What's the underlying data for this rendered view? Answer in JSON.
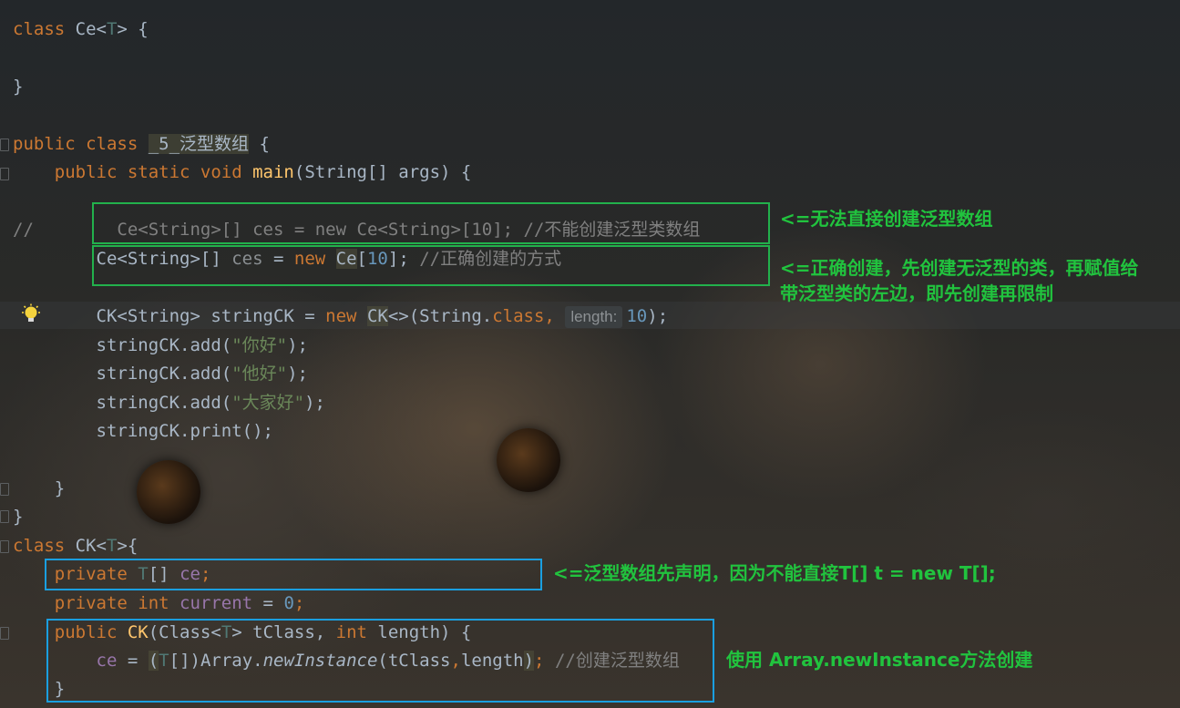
{
  "editor": {
    "lines": [
      {
        "id": "l1",
        "tokens": [
          [
            "kw",
            "class "
          ],
          [
            "",
            "Ce<"
          ],
          [
            "tp",
            "T"
          ],
          [
            "",
            "> {"
          ]
        ]
      },
      {
        "id": "l2",
        "tokens": [
          [
            "",
            "}"
          ]
        ]
      },
      {
        "id": "l3",
        "tokens": [
          [
            "kw",
            "public class "
          ],
          [
            "hl",
            "_5_泛型数组"
          ],
          [
            "",
            " {"
          ]
        ]
      },
      {
        "id": "l4",
        "tokens": [
          [
            "kw",
            "    public static void "
          ],
          [
            "fn",
            "main"
          ],
          [
            "",
            "(String[] args) {"
          ]
        ]
      },
      {
        "id": "l5",
        "tokens": [
          [
            "cmt",
            "//"
          ],
          [
            "cmt",
            "        Ce<String>[] ces = new Ce<String>[10]; //不能创建泛型类数组"
          ]
        ]
      },
      {
        "id": "l6",
        "tokens": [
          [
            "",
            "        Ce<String>[] "
          ],
          [
            "dim",
            "ces"
          ],
          [
            "",
            " = "
          ],
          [
            "kw",
            "new "
          ],
          [
            "hl",
            "Ce"
          ],
          [
            "",
            "["
          ],
          [
            "num",
            "10"
          ],
          [
            "",
            "]; "
          ],
          [
            "cmt",
            "//正确创建的方式"
          ]
        ]
      },
      {
        "id": "l7",
        "tokens": [
          [
            "",
            "        CK<String> stringCK = "
          ],
          [
            "kw",
            "new "
          ],
          [
            "hl",
            "CK"
          ],
          [
            "",
            "<>(String."
          ],
          [
            "kw",
            "class"
          ],
          [
            "kw",
            ", "
          ],
          [
            "hint",
            "length:"
          ],
          [
            "num",
            "10"
          ],
          [
            "",
            ");"
          ]
        ]
      },
      {
        "id": "l8",
        "tokens": [
          [
            "",
            "        stringCK.add("
          ],
          [
            "str",
            "\"你好\""
          ],
          [
            "",
            ");"
          ]
        ]
      },
      {
        "id": "l9",
        "tokens": [
          [
            "",
            "        stringCK.add("
          ],
          [
            "str",
            "\"他好\""
          ],
          [
            "",
            ");"
          ]
        ]
      },
      {
        "id": "l10",
        "tokens": [
          [
            "",
            "        stringCK.add("
          ],
          [
            "str",
            "\"大家好\""
          ],
          [
            "",
            ");"
          ]
        ]
      },
      {
        "id": "l11",
        "tokens": [
          [
            "",
            "        stringCK.print();"
          ]
        ]
      },
      {
        "id": "l12",
        "tokens": [
          [
            "",
            "    }"
          ]
        ]
      },
      {
        "id": "l13",
        "tokens": [
          [
            "",
            "}"
          ]
        ]
      },
      {
        "id": "l14",
        "tokens": [
          [
            "kw",
            "class "
          ],
          [
            "",
            "CK<"
          ],
          [
            "tp",
            "T"
          ],
          [
            "",
            ">{"
          ]
        ]
      },
      {
        "id": "l15",
        "tokens": [
          [
            "kw",
            "    private "
          ],
          [
            "tp",
            "T"
          ],
          [
            "",
            "[] "
          ],
          [
            "fld",
            "ce"
          ],
          [
            "kw",
            ";"
          ]
        ]
      },
      {
        "id": "l16",
        "tokens": [
          [
            "kw",
            "    private int "
          ],
          [
            "fld",
            "current"
          ],
          [
            "",
            " = "
          ],
          [
            "num",
            "0"
          ],
          [
            "kw",
            ";"
          ]
        ]
      },
      {
        "id": "l17",
        "tokens": [
          [
            "kw",
            "    public "
          ],
          [
            "fn",
            "CK"
          ],
          [
            "",
            "(Class<"
          ],
          [
            "tp",
            "T"
          ],
          [
            "",
            "> tClass, "
          ],
          [
            "kw",
            "int "
          ],
          [
            "",
            "length) {"
          ]
        ]
      },
      {
        "id": "l18",
        "tokens": [
          [
            "fld",
            "        ce"
          ],
          [
            "",
            " = "
          ],
          [
            "hl",
            "("
          ],
          [
            "tp",
            "T"
          ],
          [
            "",
            "[])Array."
          ],
          [
            "it",
            "newInstance"
          ],
          [
            "",
            "(tClass"
          ],
          [
            "kw",
            ","
          ],
          [
            "",
            "length"
          ],
          [
            "hl",
            ")"
          ],
          [
            "kw",
            "; "
          ],
          [
            "cmt",
            "//创建泛型数组"
          ]
        ]
      },
      {
        "id": "l19",
        "tokens": [
          [
            "",
            "    }"
          ]
        ]
      }
    ]
  },
  "annotations": {
    "a1": "<=无法直接创建泛型数组",
    "a2_line1": "<=正确创建，先创建无泛型的类，再赋值给",
    "a2_line2": "带泛型类的左边，即先创建再限制",
    "a3": "<=泛型数组先声明，因为不能直接T[] t = new T[];",
    "a4": "使用 Array.newInstance方法创建"
  },
  "icons": {
    "intention": "lightbulb-icon"
  },
  "colors": {
    "green_box": "#22b14c",
    "blue_box": "#1a9fe0",
    "annotation_text": "#21c33e"
  }
}
